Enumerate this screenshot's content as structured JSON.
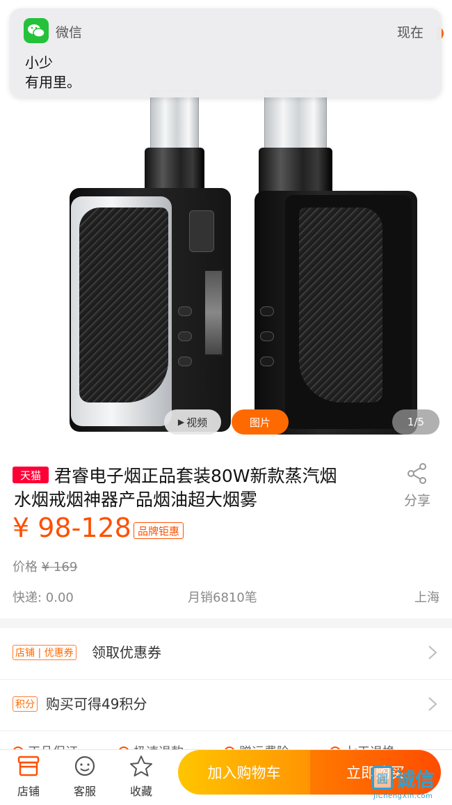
{
  "notification": {
    "app_name": "微信",
    "time": "现在",
    "sender": "小少",
    "message": "有用里。"
  },
  "gallery": {
    "video_label": "视频",
    "photo_label": "图片",
    "counter": "1/5"
  },
  "product": {
    "store_badge": "天猫",
    "title_line1": "君睿电子烟正品套装80W新款蒸汽烟",
    "title_line2": "水烟戒烟神器产品烟油超大烟雾",
    "share_label": "分享",
    "price": "¥ 98-128",
    "price_badge": "品牌钜惠",
    "original_price_label": "价格",
    "original_price": "¥ 169",
    "shipping": "快递: 0.00",
    "monthly_sales": "月销6810笔",
    "location": "上海"
  },
  "perks": {
    "coupon_badge": "店铺 | 优惠券",
    "coupon_label": "领取优惠券",
    "points_badge": "积分",
    "points_label": "购买可得49积分",
    "guarantees": [
      "正品保证",
      "极速退款",
      "赠运费险",
      "七天退换"
    ]
  },
  "bottom_bar": {
    "store_label": "店铺",
    "service_label": "客服",
    "favorite_label": "收藏",
    "add_to_cart": "加入购物车",
    "buy_now": "立即购买"
  },
  "watermark": {
    "mark": "圓",
    "brand_cn": "诚信",
    "brand_en": "JiChengXin.com"
  },
  "colors": {
    "accent": "#ff5000",
    "tmall_red": "#ff0036",
    "wechat_green": "#24c23a",
    "cart_yellow": "#ffc500",
    "buy_orange": "#ff4c00"
  }
}
